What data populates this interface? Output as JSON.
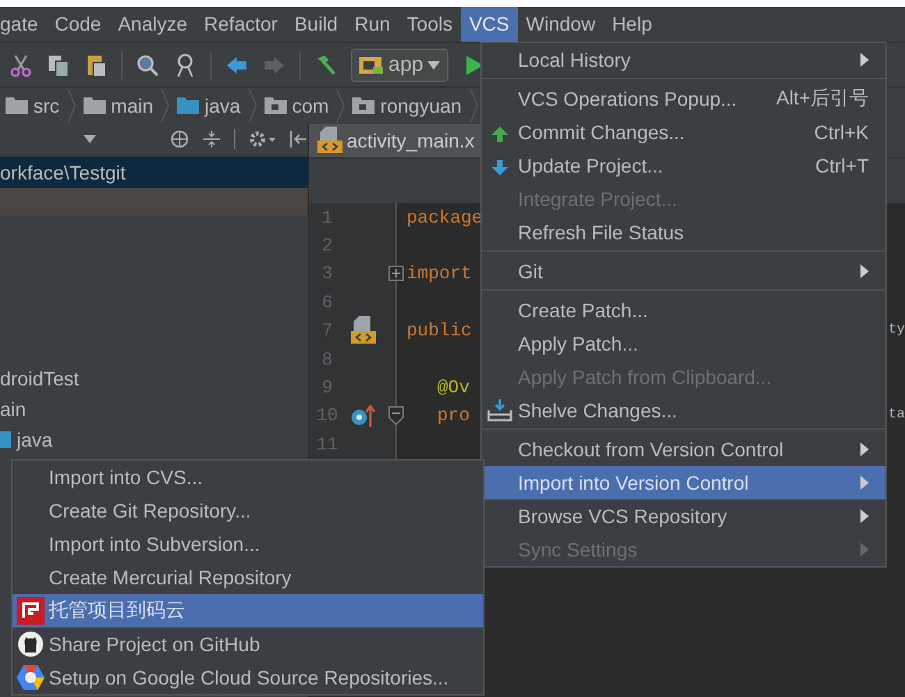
{
  "menubar": [
    {
      "label": "gate",
      "selected": false
    },
    {
      "label": "Code",
      "selected": false
    },
    {
      "label": "Analyze",
      "selected": false
    },
    {
      "label": "Refactor",
      "selected": false
    },
    {
      "label": "Build",
      "selected": false
    },
    {
      "label": "Run",
      "selected": false
    },
    {
      "label": "Tools",
      "selected": false
    },
    {
      "label": "VCS",
      "selected": true
    },
    {
      "label": "Window",
      "selected": false
    },
    {
      "label": "Help",
      "selected": false
    }
  ],
  "toolbar": {
    "run_config": "app"
  },
  "breadcrumb": [
    {
      "label": "src",
      "kind": "folder"
    },
    {
      "label": "main",
      "kind": "folder"
    },
    {
      "label": "java",
      "kind": "source"
    },
    {
      "label": "com",
      "kind": "package"
    },
    {
      "label": "rongyuan",
      "kind": "package"
    }
  ],
  "project_panel": {
    "path": "orkface\\Testgit",
    "tree": [
      {
        "label": "droidTest",
        "kind": "plain"
      },
      {
        "label": "ain",
        "kind": "plain"
      },
      {
        "label": "java",
        "kind": "source"
      }
    ]
  },
  "editor": {
    "tab": "activity_main.x",
    "lines": [
      {
        "number": "1",
        "code": "package",
        "kind": "keyword"
      },
      {
        "number": "2"
      },
      {
        "number": "3",
        "code": "import",
        "kind": "keyword"
      },
      {
        "number": "6"
      },
      {
        "number": "7",
        "code": "public",
        "kind": "keyword",
        "trailing": "ty"
      },
      {
        "number": "8"
      },
      {
        "number": "9",
        "code": "@Ov",
        "kind": "annotation",
        "indent": true
      },
      {
        "number": "10",
        "code": "pro",
        "kind": "keyword",
        "indent": true,
        "trailing": "ta"
      },
      {
        "number": "11"
      }
    ]
  },
  "vcs_menu": [
    {
      "kind": "item",
      "label": "Local History",
      "submenu": true,
      "disabled": false,
      "selected": false
    },
    {
      "kind": "separator"
    },
    {
      "kind": "item",
      "label": "VCS Operations Popup...",
      "shortcut": "Alt+后引号",
      "disabled": false,
      "selected": false
    },
    {
      "kind": "item",
      "label": "Commit Changes...",
      "shortcut": "Ctrl+K",
      "disabled": false,
      "selected": false
    },
    {
      "kind": "item",
      "label": "Update Project...",
      "shortcut": "Ctrl+T",
      "disabled": false,
      "selected": false
    },
    {
      "kind": "item",
      "label": "Integrate Project...",
      "disabled": true,
      "selected": false
    },
    {
      "kind": "item",
      "label": "Refresh File Status",
      "disabled": false,
      "selected": false
    },
    {
      "kind": "separator"
    },
    {
      "kind": "item",
      "label": "Git",
      "submenu": true,
      "disabled": false,
      "selected": false
    },
    {
      "kind": "separator"
    },
    {
      "kind": "item",
      "label": "Create Patch...",
      "disabled": false,
      "selected": false
    },
    {
      "kind": "item",
      "label": "Apply Patch...",
      "disabled": false,
      "selected": false
    },
    {
      "kind": "item",
      "label": "Apply Patch from Clipboard...",
      "disabled": true,
      "selected": false
    },
    {
      "kind": "item",
      "label": "Shelve Changes...",
      "disabled": false,
      "selected": false
    },
    {
      "kind": "separator"
    },
    {
      "kind": "item",
      "label": "Checkout from Version Control",
      "submenu": true,
      "disabled": false,
      "selected": false
    },
    {
      "kind": "item",
      "label": "Import into Version Control",
      "submenu": true,
      "disabled": false,
      "selected": true
    },
    {
      "kind": "item",
      "label": "Browse VCS Repository",
      "submenu": true,
      "disabled": false,
      "selected": false
    },
    {
      "kind": "item",
      "label": "Sync Settings",
      "submenu": true,
      "disabled": true,
      "selected": false
    }
  ],
  "import_submenu": [
    {
      "label": "Import into CVS...",
      "selected": false
    },
    {
      "label": "Create Git Repository...",
      "selected": false
    },
    {
      "label": "Import into Subversion...",
      "selected": false
    },
    {
      "label": "Create Mercurial Repository",
      "selected": false
    },
    {
      "label": "托管项目到码云",
      "selected": true
    },
    {
      "label": "Share Project on GitHub",
      "selected": false
    },
    {
      "label": "Setup on Google Cloud Source Repositories...",
      "selected": false
    }
  ]
}
